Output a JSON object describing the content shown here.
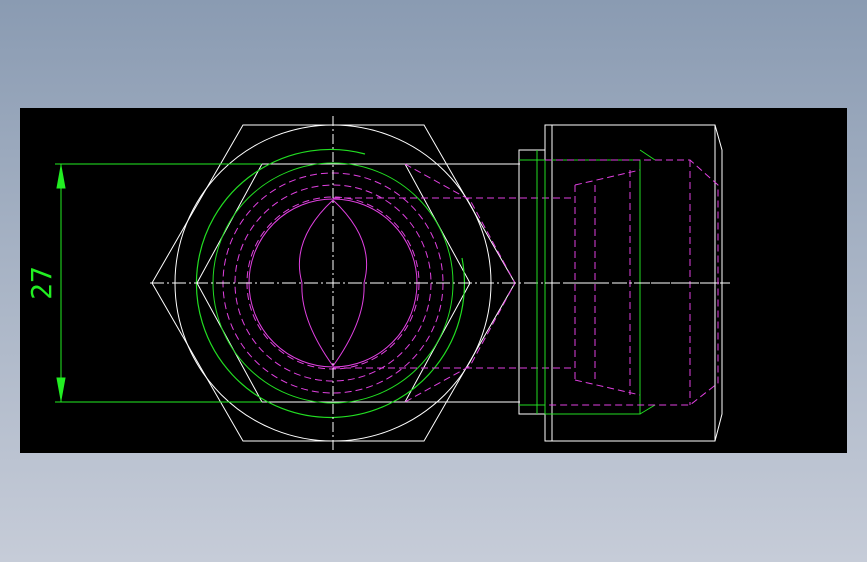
{
  "dimension": {
    "value": "27"
  },
  "colors": {
    "outline": "#ffffff",
    "dimension": "#22ee22",
    "hidden": "#e040e0",
    "thread": "#22dd22"
  }
}
